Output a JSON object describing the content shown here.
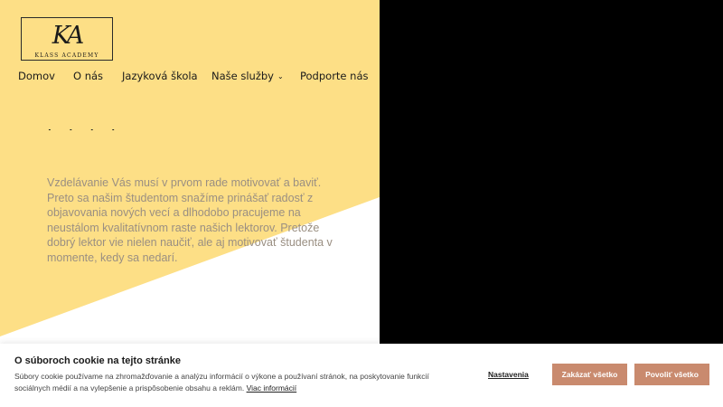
{
  "brand": {
    "monogram": "KA",
    "name": "KLASS ACADEMY"
  },
  "nav": {
    "items": [
      {
        "label": "Domov"
      },
      {
        "label": "O nás"
      },
      {
        "label": "Jazyková škola"
      },
      {
        "label": "Naše služby"
      },
      {
        "label": "Podporte nás"
      }
    ]
  },
  "hero": {
    "heading_fragment": "· · ·   ·",
    "body": "Vzdelávanie Vás musí v prvom rade motivovať a baviť. Preto sa našim študentom snažíme prinášať radosť z objavovania nových vecí a dlhodobo pracujeme na neustálom kvalitatívnom raste našich lektorov. Pretože dobrý lektor vie nielen naučiť, ale aj motivovať študenta v momente, kedy sa nedarí."
  },
  "cookie": {
    "title": "O súboroch cookie na tejto stránke",
    "description": "Súbory cookie používame na zhromažďovanie a analýzu informácií o výkone a používaní stránok, na poskytovanie funkcií sociálnych médií a na vylepšenie a prispôsobenie obsahu a reklám.",
    "more_link": "Viac informácií",
    "settings_label": "Nastavenia",
    "deny_label": "Zakázať všetko",
    "allow_label": "Povoliť všetko"
  },
  "colors": {
    "accent_yellow": "#FDDF86",
    "button": "#C98A6E",
    "body_text": "#9A8F82"
  }
}
